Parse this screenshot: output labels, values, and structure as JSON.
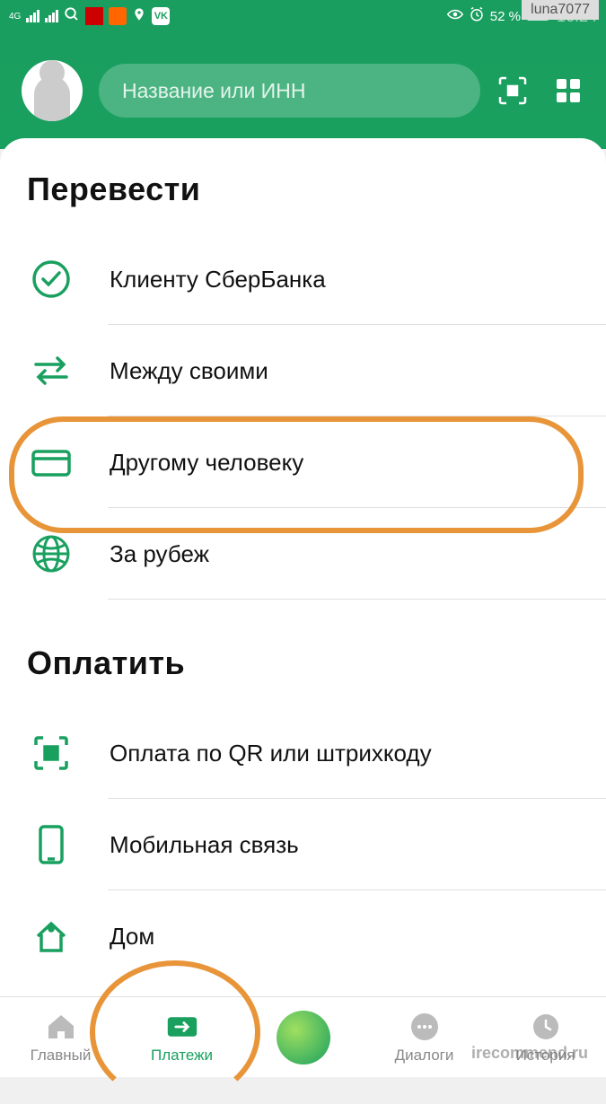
{
  "statusbar": {
    "network": "4G",
    "battery_text": "52 %",
    "time": "16:24"
  },
  "header": {
    "search_placeholder": "Название или ИНН"
  },
  "sections": {
    "transfer": {
      "title": "Перевести",
      "items": [
        {
          "label": "Клиенту СберБанка",
          "icon": "check-circle"
        },
        {
          "label": "Между своими",
          "icon": "arrows"
        },
        {
          "label": "Другому человеку",
          "icon": "card"
        },
        {
          "label": "За рубеж",
          "icon": "globe"
        }
      ]
    },
    "pay": {
      "title": "Оплатить",
      "items": [
        {
          "label": "Оплата по QR или штрихкоду",
          "icon": "qr"
        },
        {
          "label": "Мобильная связь",
          "icon": "phone"
        },
        {
          "label": "Дом",
          "icon": "home"
        }
      ]
    }
  },
  "nav": {
    "items": [
      {
        "label": "Главный",
        "icon": "home"
      },
      {
        "label": "Платежи",
        "icon": "arrow"
      },
      {
        "label": "",
        "icon": "orb"
      },
      {
        "label": "Диалоги",
        "icon": "chat"
      },
      {
        "label": "История",
        "icon": "clock"
      }
    ],
    "active_index": 1
  },
  "overlay": {
    "watermark_tag": "luna7077",
    "watermark_bottom": "irecommend.ru"
  },
  "colors": {
    "brand": "#19a05f",
    "annotation": "#e8953a"
  }
}
